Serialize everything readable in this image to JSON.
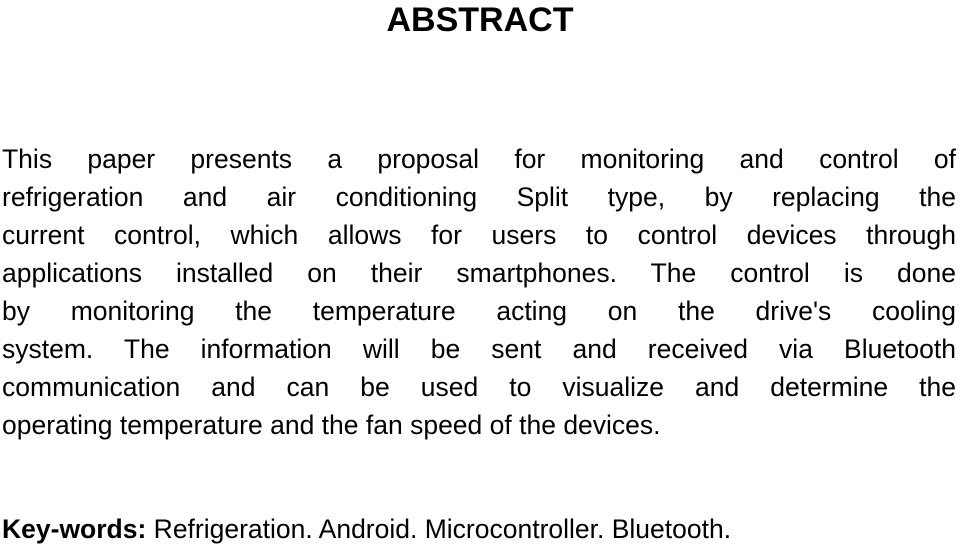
{
  "document": {
    "title": "ABSTRACT",
    "abstract_lines": [
      "This paper presents a proposal for monitoring and control of",
      "refrigeration and air conditioning Split type, by replacing the",
      "current control, which allows for users to control devices through",
      "applications installed on their smartphones. The control is done",
      "by monitoring the temperature acting on the drive's cooling",
      "system. The information will be sent and received via Bluetooth",
      "communication and can be used to visualize and determine the",
      "operating temperature and the fan speed of the devices."
    ],
    "keywords": {
      "label": "Key-words:",
      "text": " Refrigeration. Android. Microcontroller. Bluetooth."
    }
  }
}
